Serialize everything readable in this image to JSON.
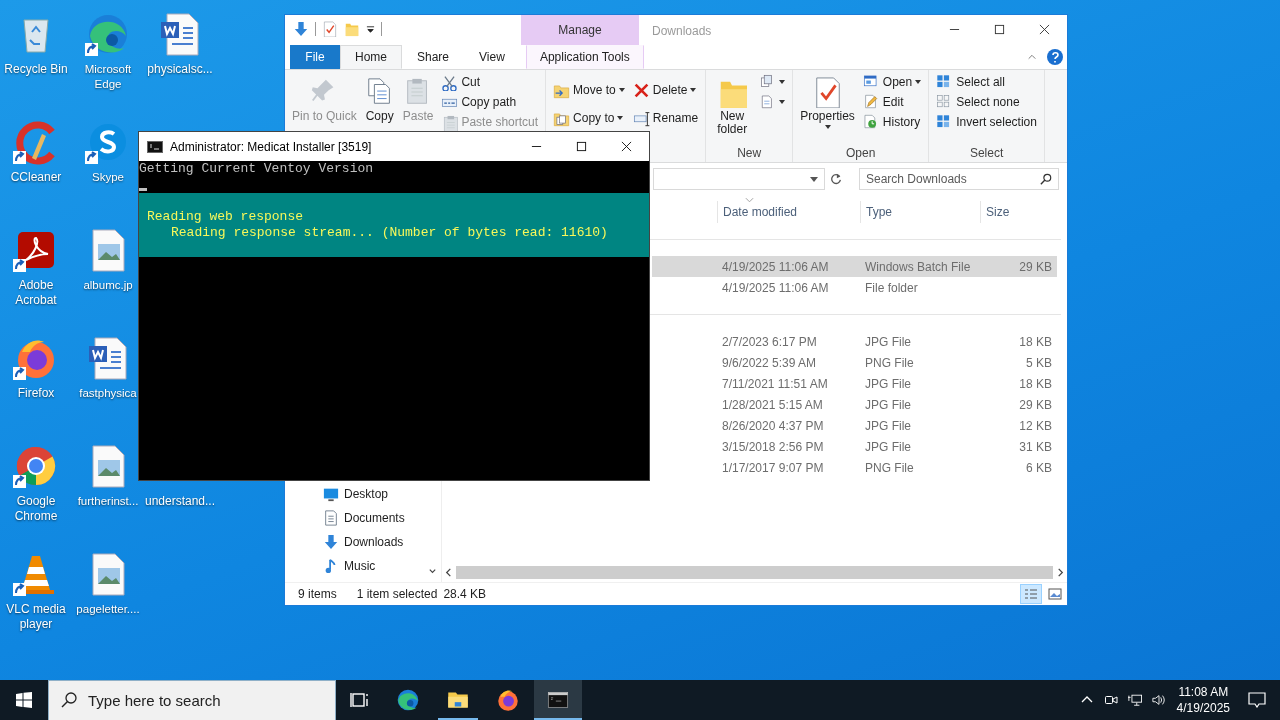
{
  "desktop": {
    "columns": [
      [
        {
          "label": "Recycle Bin",
          "kind": "file"
        },
        {
          "label": "CCleaner",
          "kind": "shortcut"
        },
        {
          "label": "Adobe Acrobat",
          "kind": "shortcut"
        },
        {
          "label": "Firefox",
          "kind": "shortcut"
        },
        {
          "label": "Google Chrome",
          "kind": "shortcut"
        },
        {
          "label": "VLC media player",
          "kind": "shortcut"
        }
      ],
      [
        {
          "label": "Microsoft Edge",
          "kind": "shortcut"
        },
        {
          "label": "Skype",
          "kind": "shortcut"
        },
        {
          "label": "albumc.jp",
          "kind": "file"
        },
        {
          "label": "fastphysica",
          "kind": "file"
        },
        {
          "label": "furtherinst...",
          "kind": "file"
        },
        {
          "label": "pageletter....",
          "kind": "file"
        }
      ],
      [
        {
          "label": "physicalsc...",
          "kind": "file"
        },
        {
          "label": "understand..."
        }
      ]
    ]
  },
  "explorer": {
    "title": "Downloads",
    "contextual_header": "Manage",
    "tabs": [
      {
        "label": "File",
        "kind": "menu",
        "selected": false
      },
      {
        "label": "Home",
        "kind": "tab",
        "selected": true
      },
      {
        "label": "Share",
        "kind": "tab",
        "selected": false
      },
      {
        "label": "View",
        "kind": "tab",
        "selected": false
      },
      {
        "label": "Application Tools",
        "kind": "contextual",
        "selected": false
      }
    ],
    "ribbon": {
      "groups": [
        {
          "columns": [
            [
              {
                "label": "Pin to Quick",
                "kind": "large",
                "disabled": true,
                "dropdown": false
              }
            ],
            [
              {
                "label": "Copy",
                "kind": "large",
                "disabled": false,
                "dropdown": false
              }
            ],
            [
              {
                "label": "Paste",
                "kind": "large",
                "disabled": true,
                "dropdown": false
              }
            ],
            [
              {
                "label": "Cut",
                "kind": "small",
                "disabled": false,
                "dropdown": false
              },
              {
                "label": "Copy path",
                "kind": "small",
                "disabled": false,
                "dropdown": false
              },
              {
                "label": "Paste shortcut",
                "kind": "small",
                "disabled": true,
                "dropdown": false
              }
            ]
          ]
        },
        {
          "columns": [
            [
              {
                "label": "Move to",
                "kind": "small",
                "disabled": false,
                "dropdown": true
              },
              {
                "label": "Copy to",
                "kind": "small",
                "disabled": false,
                "dropdown": true
              }
            ],
            [
              {
                "label": "Delete",
                "kind": "small",
                "disabled": false,
                "dropdown": true
              },
              {
                "label": "Rename",
                "kind": "small",
                "disabled": false,
                "dropdown": false
              }
            ]
          ]
        },
        {
          "label": "New",
          "columns": [
            [
              {
                "label": "New folder",
                "kind": "large",
                "disabled": false,
                "dropdown": false
              }
            ],
            [
              {
                "kind": "small",
                "disabled": false,
                "dropdown": true
              },
              {
                "kind": "small",
                "disabled": false,
                "dropdown": true
              }
            ]
          ]
        },
        {
          "label": "Open",
          "columns": [
            [
              {
                "label": "Properties",
                "kind": "large",
                "disabled": false,
                "dropdown": true
              }
            ],
            [
              {
                "label": "Open",
                "kind": "small",
                "disabled": false,
                "dropdown": true
              },
              {
                "label": "Edit",
                "kind": "small",
                "disabled": false,
                "dropdown": false
              },
              {
                "label": "History",
                "kind": "small",
                "disabled": false,
                "dropdown": false
              }
            ]
          ]
        },
        {
          "label": "Select",
          "columns": [
            [
              {
                "label": "Select all",
                "kind": "small",
                "disabled": false,
                "dropdown": false
              },
              {
                "label": "Select none",
                "kind": "small",
                "disabled": false,
                "dropdown": false
              },
              {
                "label": "Invert selection",
                "kind": "small",
                "disabled": false,
                "dropdown": false
              }
            ]
          ]
        }
      ]
    },
    "search": {
      "placeholder": "Search Downloads"
    },
    "columns": [
      "Date modified",
      "Type",
      "Size"
    ],
    "groups": [
      {
        "rows": [
          {
            "date": "4/19/2025 11:06 AM",
            "type": "Windows Batch File",
            "size": "29 KB",
            "selected": true
          },
          {
            "date": "4/19/2025 11:06 AM",
            "type": "File folder",
            "selected": false
          }
        ]
      },
      {
        "rows": [
          {
            "date": "2/7/2023 6:17 PM",
            "type": "JPG File",
            "size": "18 KB",
            "selected": false
          },
          {
            "date": "9/6/2022 5:39 AM",
            "type": "PNG File",
            "size": "5 KB",
            "selected": false
          },
          {
            "date": "7/11/2021 11:51 AM",
            "type": "JPG File",
            "size": "18 KB",
            "selected": false
          },
          {
            "date": "1/28/2021 5:15 AM",
            "type": "JPG File",
            "size": "29 KB",
            "selected": false
          },
          {
            "date": "8/26/2020 4:37 PM",
            "type": "JPG File",
            "size": "12 KB",
            "selected": false
          },
          {
            "date": "3/15/2018 2:56 PM",
            "type": "JPG File",
            "size": "31 KB",
            "selected": false
          },
          {
            "date": "1/17/2017 9:07 PM",
            "type": "PNG File",
            "size": "6 KB",
            "selected": false
          }
        ]
      }
    ],
    "nav": [
      {
        "label": "Desktop"
      },
      {
        "label": "Documents"
      },
      {
        "label": "Downloads"
      },
      {
        "label": "Music"
      }
    ],
    "status": {
      "count": "9 items",
      "selection": "1 item selected",
      "size": "28.4 KB"
    },
    "views": [
      {
        "selected": true
      },
      {
        "selected": false
      }
    ]
  },
  "console": {
    "title": "Administrator:  Medicat Installer [3519]",
    "lines": [
      "Getting Current Ventoy Version"
    ],
    "progress": {
      "title": "Reading web response",
      "detail": "Reading response stream... (Number of bytes read: 11610)"
    }
  },
  "taskbar": {
    "search": {
      "placeholder": "Type here to search"
    },
    "apps": [
      {
        "running": false,
        "selected": false
      },
      {
        "running": true,
        "selected": false
      },
      {
        "running": false,
        "selected": false
      },
      {
        "running": true,
        "selected": true
      }
    ],
    "time": "11:08 AM",
    "date": "4/19/2025"
  }
}
